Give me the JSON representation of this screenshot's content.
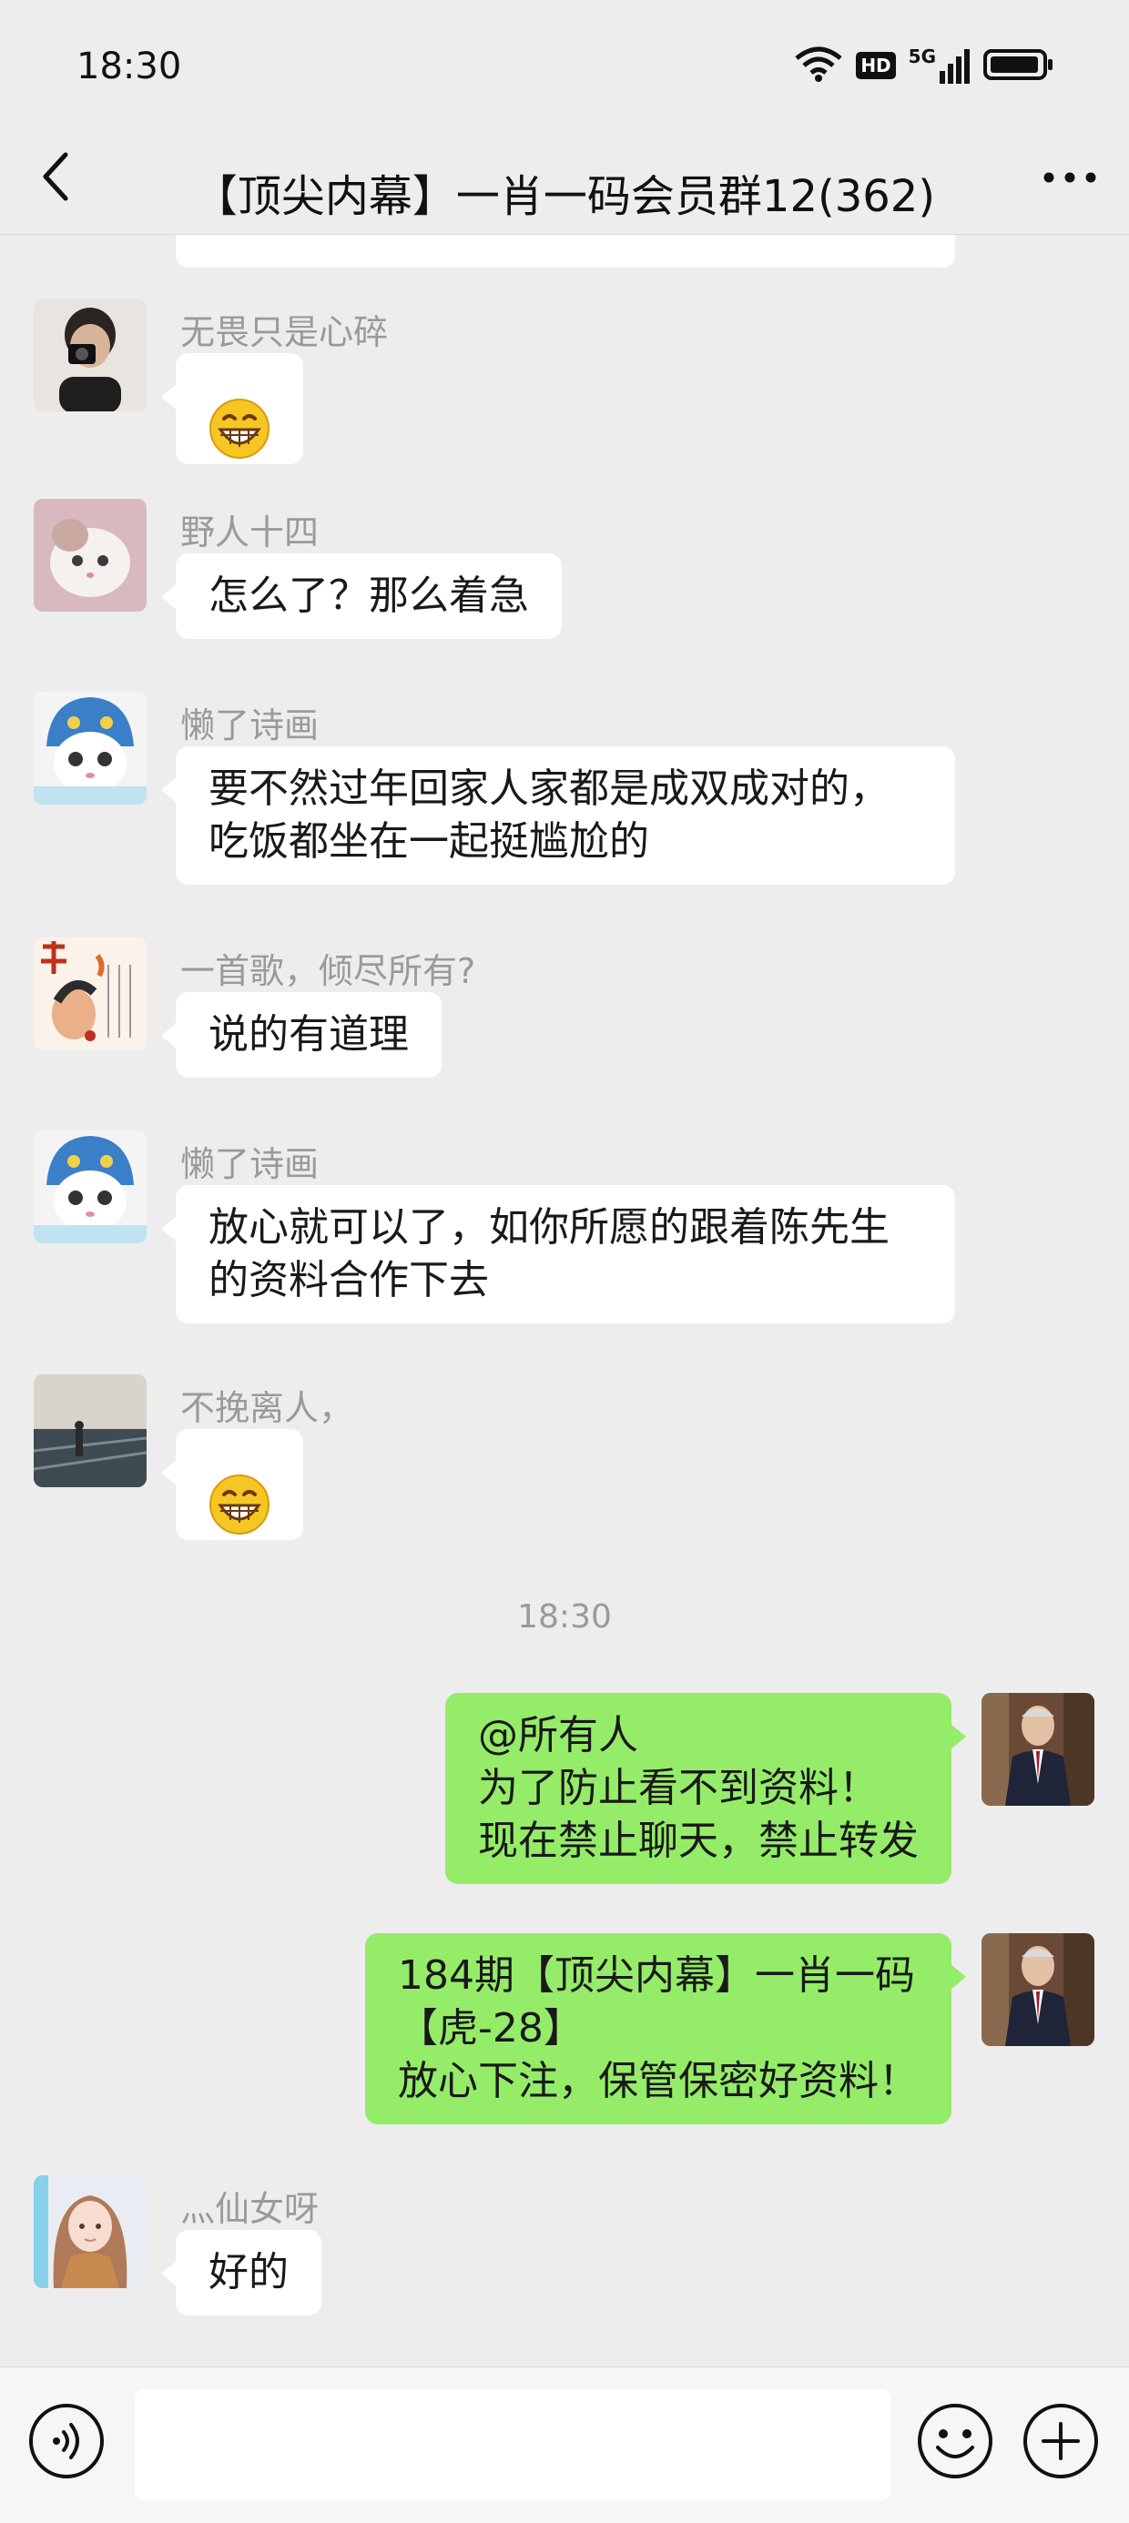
{
  "status_bar": {
    "time": "18:30",
    "hd_label": "HD",
    "network_label": "5G"
  },
  "header": {
    "title": "【顶尖内幕】一肖一码会员群12(362)"
  },
  "messages": [
    {
      "sender": "无畏只是心碎",
      "text": "😁",
      "type": "emoji"
    },
    {
      "sender": "野人十四",
      "text": "怎么了？那么着急"
    },
    {
      "sender": "懒了诗画",
      "text": "要不然过年回家人家都是成双成对的，\n吃饭都坐在一起挺尴尬的"
    },
    {
      "sender": "一首歌，倾尽所有?",
      "text": "说的有道理"
    },
    {
      "sender": "懒了诗画",
      "text": "放心就可以了，如你所愿的跟着陈先生\n的资料合作下去"
    },
    {
      "sender": "不挽离人，",
      "text": "😁",
      "type": "emoji"
    },
    {
      "sender": "",
      "text": "@所有人\n为了防止看不到资料！\n现在禁止聊天，禁止转发",
      "outgoing": true
    },
    {
      "sender": "",
      "text": "184期【顶尖内幕】一肖一码\n【虎-28】\n放心下注，保管保密好资料！",
      "outgoing": true
    },
    {
      "sender": "灬仙女呀",
      "text": "好的"
    }
  ],
  "time_separator": "18:30",
  "input": {
    "value": "",
    "placeholder": ""
  },
  "icons": {
    "back": "back-arrow-icon",
    "more": "more-dots-icon",
    "voice": "voice-icon",
    "emoji": "emoji-icon",
    "plus": "plus-icon"
  },
  "colors": {
    "background": "#ededed",
    "outgoing_bubble": "#95ec69",
    "incoming_bubble": "#ffffff",
    "meta_text": "#9a9a9a"
  }
}
